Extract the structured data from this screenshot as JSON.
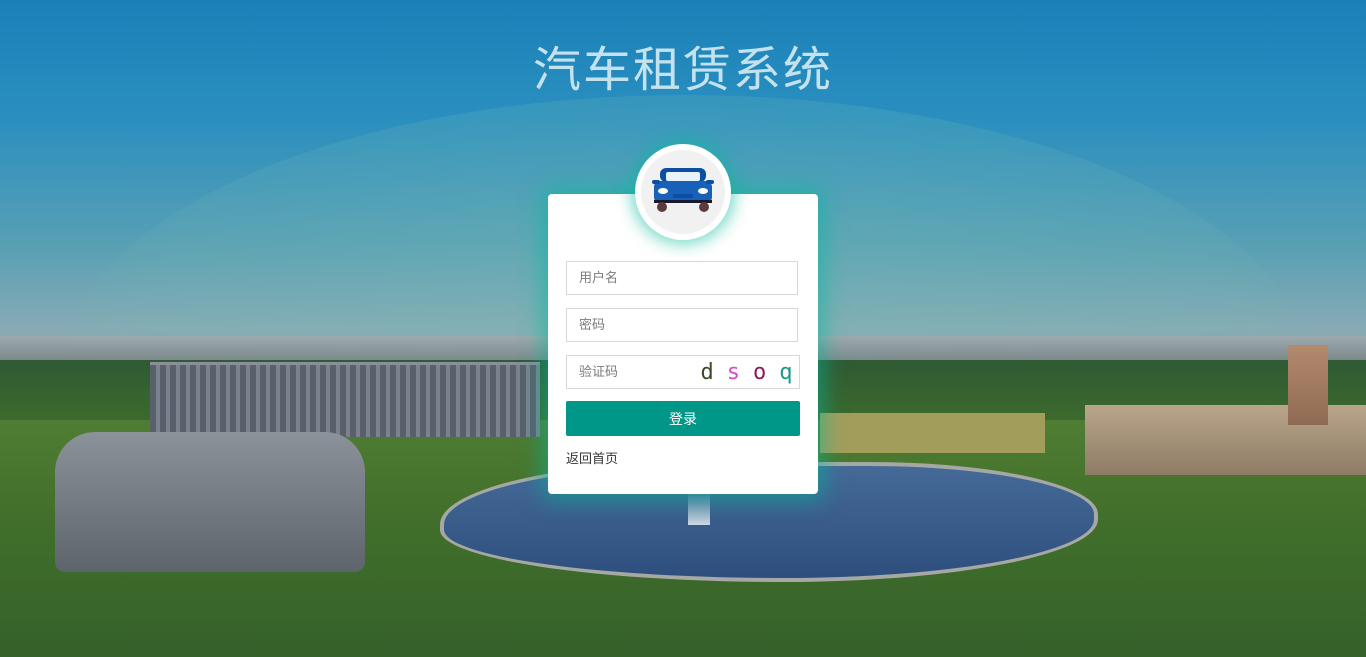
{
  "page": {
    "title": "汽车租赁系统"
  },
  "avatar": {
    "icon": "car-icon"
  },
  "form": {
    "username": {
      "placeholder": "用户名",
      "value": ""
    },
    "password": {
      "placeholder": "密码",
      "value": ""
    },
    "captcha": {
      "placeholder": "验证码",
      "value": ""
    },
    "captcha_image": {
      "chars": [
        {
          "text": "d",
          "color": "#3a4a2a"
        },
        {
          "text": "s",
          "color": "#d64fc0"
        },
        {
          "text": "o",
          "color": "#8a1c5a"
        },
        {
          "text": "q",
          "color": "#1a9a8a"
        }
      ]
    },
    "login_label": "登录",
    "back_home_label": "返回首页"
  },
  "colors": {
    "primary": "#009688",
    "title": "#c4e2ee",
    "glow": "#00b99b"
  }
}
